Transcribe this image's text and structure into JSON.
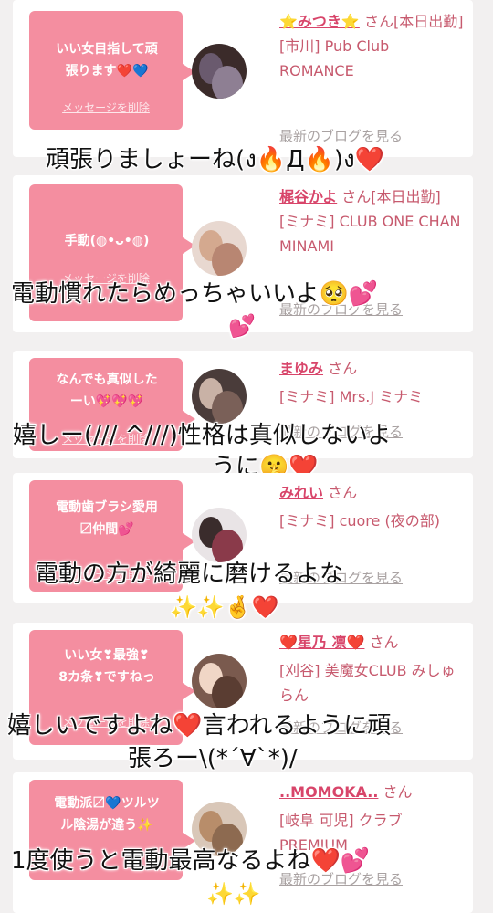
{
  "cards": [
    {
      "message": "いい女目指して頑\n張ります❤️💙",
      "delete_label": "メッセージを削除",
      "name": "⭐みつき⭐",
      "suffix": "さん[本日出勤]",
      "shop": "[市川] Pub Club ROMANCE",
      "blog": "最新のブログを見る",
      "overlay": "頑張りましょーね(ง🔥Д🔥)ง❤️",
      "overlay2": ""
    },
    {
      "message": "手動(◍•ᴗ•◍)",
      "delete_label": "メッセージを削除",
      "name": "梶谷かよ",
      "suffix": "さん[本日出勤]",
      "shop": "[ミナミ] CLUB ONE CHAN MINAMI",
      "blog": "最新のブログを見る",
      "overlay": "電動慣れたらめっちゃいいよ🥺💕",
      "overlay2": "💕"
    },
    {
      "message": "なんでも真似した\nーい💖💖💖",
      "delete_label": "メッセージを削除",
      "name": "まゆみ",
      "suffix": "さん",
      "shop": "[ミナミ] Mrs.J ミナミ",
      "blog": "最新のブログを見る",
      "overlay": "嬉しー(/// ^///)性格は真似しないよ",
      "overlay2": "うに🤫❤️"
    },
    {
      "message": "電動歯ブラシ愛用\n〼仲間💕",
      "delete_label": "メッセージを削除",
      "name": "みれい",
      "suffix": "さん",
      "shop": "[ミナミ] cuore (夜の部)",
      "blog": "最新のブログを見る",
      "overlay": "電動の方が綺麗に磨けるよな",
      "overlay2": "✨✨🤞❤️"
    },
    {
      "message": "いい女❣最強❣\n8カ条❣ですねっ",
      "delete_label": "メッセージを削除",
      "name": "❤️星乃 凛❤️",
      "suffix": "さん",
      "shop": "[刈谷] 美魔女CLUB みしゅらん",
      "blog": "最新のブログを見る",
      "overlay": "嬉しいですよね❤️言われるように頑",
      "overlay2": "張ろー\\(*´∀`*)/"
    },
    {
      "message": "電動派〼💙ツルツ\nル陰湯が違う✨",
      "delete_label": "メッセージを削除",
      "name": "..MOMOKA..",
      "suffix": "さん",
      "shop": "[岐阜 可児] クラブ PREMIUM",
      "blog": "最新のブログを見る",
      "overlay": "1度使うと電動最高なるよね❤️💕",
      "overlay2": "✨✨"
    }
  ],
  "colors": {
    "bubble": "#f48ea0",
    "name": "#d8456a",
    "text": "#c75a6e",
    "background": "#f2f0f0"
  }
}
